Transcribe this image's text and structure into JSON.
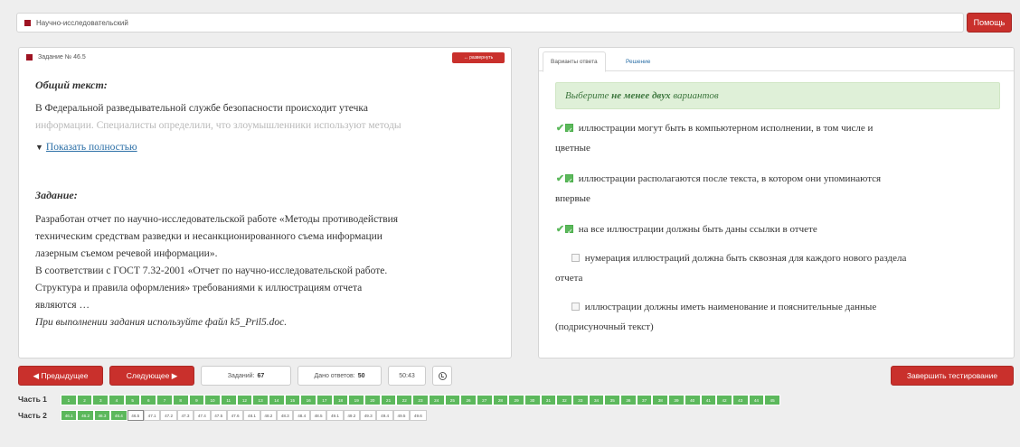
{
  "topbar": {
    "title": "Научно-исследовательский",
    "help_label": "Помощь"
  },
  "task": {
    "heading": "Задание № 46.5",
    "expand_label": "↔ развернуть",
    "general_title": "Общий текст:",
    "general_line1": "В Федеральной разведывательной службе безопасности происходит утечка",
    "general_line2": "информации. Специалисты определили, что злоумышленники используют методы",
    "show_more": "Показать полностью",
    "task_title": "Задание:",
    "task_lines": [
      "Разработан отчет по научно-исследовательской работе «Методы противодействия",
      "техническим средствам разведки и несанкционированного съема информации",
      "лазерным съемом речевой информации».",
      "В соответствии с ГОСТ 7.32-2001 «Отчет по научно-исследовательской работе.",
      "Структура и правила оформления» требованиями к иллюстрациям отчета",
      "являются …"
    ],
    "note": "При выполнении задания используйте файл k5_Pril5.doc."
  },
  "answers": {
    "tab_variants": "Варианты ответа",
    "tab_solution": "Решение",
    "hint_pre": "Выберите",
    "hint_bold": "не менее двух",
    "hint_post": "вариантов",
    "options": [
      {
        "line1": "иллюстрации могут быть в компьютерном исполнении, в том числе и",
        "line2": "цветные",
        "checked": true
      },
      {
        "line1": "иллюстрации располагаются после текста, в котором они упоминаются",
        "line2": "впервые",
        "checked": true
      },
      {
        "line1": "на все иллюстрации должны быть даны ссылки в отчете",
        "line2": "",
        "checked": true
      },
      {
        "line1": "нумерация иллюстраций должна быть сквозная для каждого нового раздела",
        "line2": "отчета",
        "checked": false
      },
      {
        "line1": "иллюстрации должны иметь наименование и пояснительные данные",
        "line2": "(подрисуночный текст)",
        "checked": false
      }
    ]
  },
  "nav": {
    "prev_label": "◀ Предыдущее",
    "next_label": "Следующее ▶",
    "tasks_label": "Заданий:",
    "tasks_value": "67",
    "answered_label": "Дано ответов:",
    "answered_value": "50",
    "timer": "50:43",
    "finish_label": "Завершить тестирование"
  },
  "parts": {
    "part1_label": "Часть 1",
    "part2_label": "Часть 2",
    "part1_cells": [
      "1",
      "2",
      "3",
      "4",
      "5",
      "6",
      "7",
      "8",
      "9",
      "10",
      "11",
      "12",
      "13",
      "14",
      "15",
      "16",
      "17",
      "18",
      "19",
      "20",
      "21",
      "22",
      "23",
      "24",
      "25",
      "26",
      "27",
      "28",
      "29",
      "30",
      "31",
      "32",
      "33",
      "34",
      "35",
      "36",
      "37",
      "38",
      "39",
      "40",
      "41",
      "42",
      "43",
      "44",
      "45"
    ],
    "part2_cells": [
      {
        "label": "46.1",
        "state": "done"
      },
      {
        "label": "46.2",
        "state": "done"
      },
      {
        "label": "46.3",
        "state": "done"
      },
      {
        "label": "46.4",
        "state": "done"
      },
      {
        "label": "46.5",
        "state": "current"
      },
      {
        "label": "47.1",
        "state": "todo"
      },
      {
        "label": "47.2",
        "state": "todo"
      },
      {
        "label": "47.3",
        "state": "todo"
      },
      {
        "label": "47.4",
        "state": "todo"
      },
      {
        "label": "47.5",
        "state": "todo"
      },
      {
        "label": "47.6",
        "state": "todo"
      },
      {
        "label": "48.1",
        "state": "todo"
      },
      {
        "label": "48.2",
        "state": "todo"
      },
      {
        "label": "48.3",
        "state": "todo"
      },
      {
        "label": "48.4",
        "state": "todo"
      },
      {
        "label": "48.5",
        "state": "todo"
      },
      {
        "label": "49.1",
        "state": "todo"
      },
      {
        "label": "49.2",
        "state": "todo"
      },
      {
        "label": "49.3",
        "state": "todo"
      },
      {
        "label": "49.4",
        "state": "todo"
      },
      {
        "label": "49.5",
        "state": "todo"
      },
      {
        "label": "49.6",
        "state": "todo"
      }
    ]
  },
  "colors": {
    "brand_red": "#c9302c",
    "success_green": "#5cb85c"
  }
}
